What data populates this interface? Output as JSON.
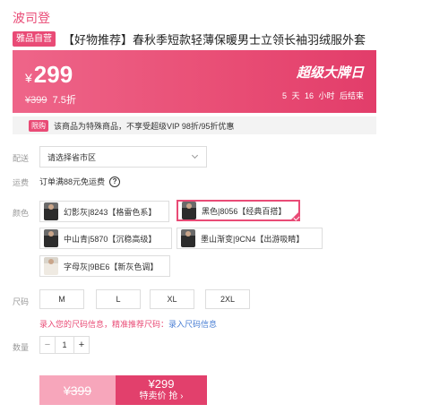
{
  "brand": "波司登",
  "product": {
    "badge": "雅品自营",
    "title": "【好物推荐】春秋季短款轻薄保暖男士立领长袖羽绒服外套"
  },
  "price": {
    "currency": "¥",
    "current": "299",
    "original": "¥399",
    "discount": "7.5折",
    "promo_name": "超级大牌日",
    "countdown": "5 天 16 小时 后结束"
  },
  "notice": {
    "tag": "限购",
    "text": "该商品为特殊商品，不享受超级VIP 98折/95折优惠"
  },
  "delivery": {
    "label": "配送",
    "placeholder": "请选择省市区"
  },
  "shipping": {
    "label": "运费",
    "text": "订单满88元免运费"
  },
  "color": {
    "label": "颜色",
    "options": [
      {
        "label": "幻影灰|8243【格雷色系】",
        "selected": false
      },
      {
        "label": "黑色|8056【经典百搭】",
        "selected": true
      },
      {
        "label": "中山青|5870【沉稳高级】",
        "selected": false
      },
      {
        "label": "墨山渐变|9CN4【出游吸睛】",
        "selected": false
      },
      {
        "label": "字母灰|9BE6【新灰色调】",
        "selected": false
      }
    ]
  },
  "size": {
    "label": "尺码",
    "options": [
      "M",
      "L",
      "XL",
      "2XL"
    ],
    "hint": "录入您的尺码信息，精准推荐尺码：",
    "hint_link": "录入尺码信息"
  },
  "quantity": {
    "label": "数量",
    "value": "1",
    "minus": "−",
    "plus": "+"
  },
  "buy": {
    "original": "¥399",
    "price": "¥299",
    "action": "特卖价 抢 ›"
  },
  "colors": {
    "accent": "#e94b76",
    "buy": "#e2406c"
  }
}
